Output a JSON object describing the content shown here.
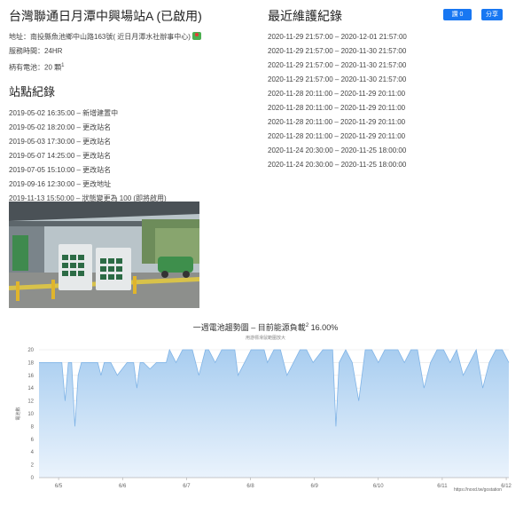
{
  "station": {
    "title": "台灣聯通日月潭中興場站A (已啟用)",
    "address_label": "地址：",
    "address": "南投縣魚池鄉中山路163號( 近日月潭水社辦事中心)",
    "hours_label": "服務時間：",
    "hours": "24HR",
    "capacity_label": "柄有電池：",
    "capacity": "20 顆",
    "capacity_note": "1"
  },
  "history": {
    "title": "站點紀錄",
    "entries": [
      "2019-05-02 16:35:00 – 新增建置中",
      "2019-05-02 18:20:00 – 更改站名",
      "2019-05-03 17:30:00 – 更改站名",
      "2019-05-07 14:25:00 – 更改站名",
      "2019-07-05 15:10:00 – 更改站名",
      "2019-09-16 12:30:00 – 更改地址",
      "2019-11-13 15:50:00 – 狀態變更為 100 (即將啟用)",
      "2019-11-29 13:10:00 – 啟用"
    ]
  },
  "maintenance": {
    "title": "最近維護紀錄",
    "entries": [
      "2020-11-29 21:57:00 – 2020-12-01 21:57:00",
      "2020-11-29 21:57:00 – 2020-11-30 21:57:00",
      "2020-11-29 21:57:00 – 2020-11-30 21:57:00",
      "2020-11-29 21:57:00 – 2020-11-30 21:57:00",
      "2020-11-28 20:11:00 – 2020-11-29 20:11:00",
      "2020-11-28 20:11:00 – 2020-11-29 20:11:00",
      "2020-11-28 20:11:00 – 2020-11-29 20:11:00",
      "2020-11-28 20:11:00 – 2020-11-29 20:11:00",
      "2020-11-24 20:30:00 – 2020-11-25 18:00:00",
      "2020-11-24 20:30:00 – 2020-11-25 18:00:00"
    ]
  },
  "social": {
    "like_label": "讚 0",
    "share_label": "分享"
  },
  "colors": {
    "area_fill": "#a8cdf0",
    "area_line": "#7fb3e6",
    "social_blue": "#1877f2"
  },
  "chart_data": {
    "type": "area",
    "title": "一週電池趨勢圖 – 目前能源負載",
    "title_sup": "2",
    "title_value": "16.00%",
    "subtitle": "用游標滑鼠範圍放大",
    "ylabel": "電池數",
    "ylim": [
      0,
      20
    ],
    "yticks": [
      0,
      2,
      4,
      6,
      8,
      10,
      12,
      14,
      16,
      18,
      20
    ],
    "xticks": [
      "6/5",
      "6/6",
      "6/7",
      "6/8",
      "6/9",
      "6/10",
      "6/11",
      "6/12"
    ],
    "x": [
      0,
      0.2,
      0.35,
      0.4,
      0.45,
      0.5,
      0.55,
      0.6,
      0.65,
      0.75,
      0.9,
      0.95,
      1.0,
      1.05,
      1.1,
      1.2,
      1.35,
      1.45,
      1.5,
      1.55,
      1.6,
      1.7,
      1.8,
      1.95,
      2.0,
      2.1,
      2.2,
      2.35,
      2.45,
      2.55,
      2.6,
      2.7,
      2.8,
      2.9,
      3.0,
      3.05,
      3.15,
      3.25,
      3.35,
      3.45,
      3.5,
      3.6,
      3.7,
      3.8,
      3.9,
      4.0,
      4.1,
      4.2,
      4.35,
      4.5,
      4.55,
      4.6,
      4.7,
      4.8,
      4.9,
      5.0,
      5.1,
      5.2,
      5.3,
      5.4,
      5.5,
      5.6,
      5.7,
      5.8,
      5.9,
      6.0,
      6.1,
      6.2,
      6.3,
      6.4,
      6.5,
      6.6,
      6.7,
      6.8,
      6.9,
      7.0,
      7.1,
      7.2
    ],
    "y": [
      18,
      18,
      18,
      12,
      18,
      18,
      8,
      16,
      18,
      18,
      18,
      16,
      18,
      18,
      18,
      16,
      18,
      18,
      14,
      18,
      18,
      17,
      18,
      18,
      20,
      18,
      20,
      20,
      16,
      20,
      20,
      18,
      20,
      20,
      20,
      16,
      18,
      20,
      20,
      20,
      18,
      20,
      20,
      16,
      18,
      20,
      20,
      18,
      20,
      20,
      8,
      18,
      20,
      18,
      12,
      20,
      20,
      18,
      20,
      20,
      20,
      18,
      20,
      20,
      14,
      18,
      20,
      20,
      18,
      20,
      16,
      18,
      20,
      14,
      18,
      20,
      20,
      18
    ]
  },
  "credit": "https://noxd.tw/gostation"
}
